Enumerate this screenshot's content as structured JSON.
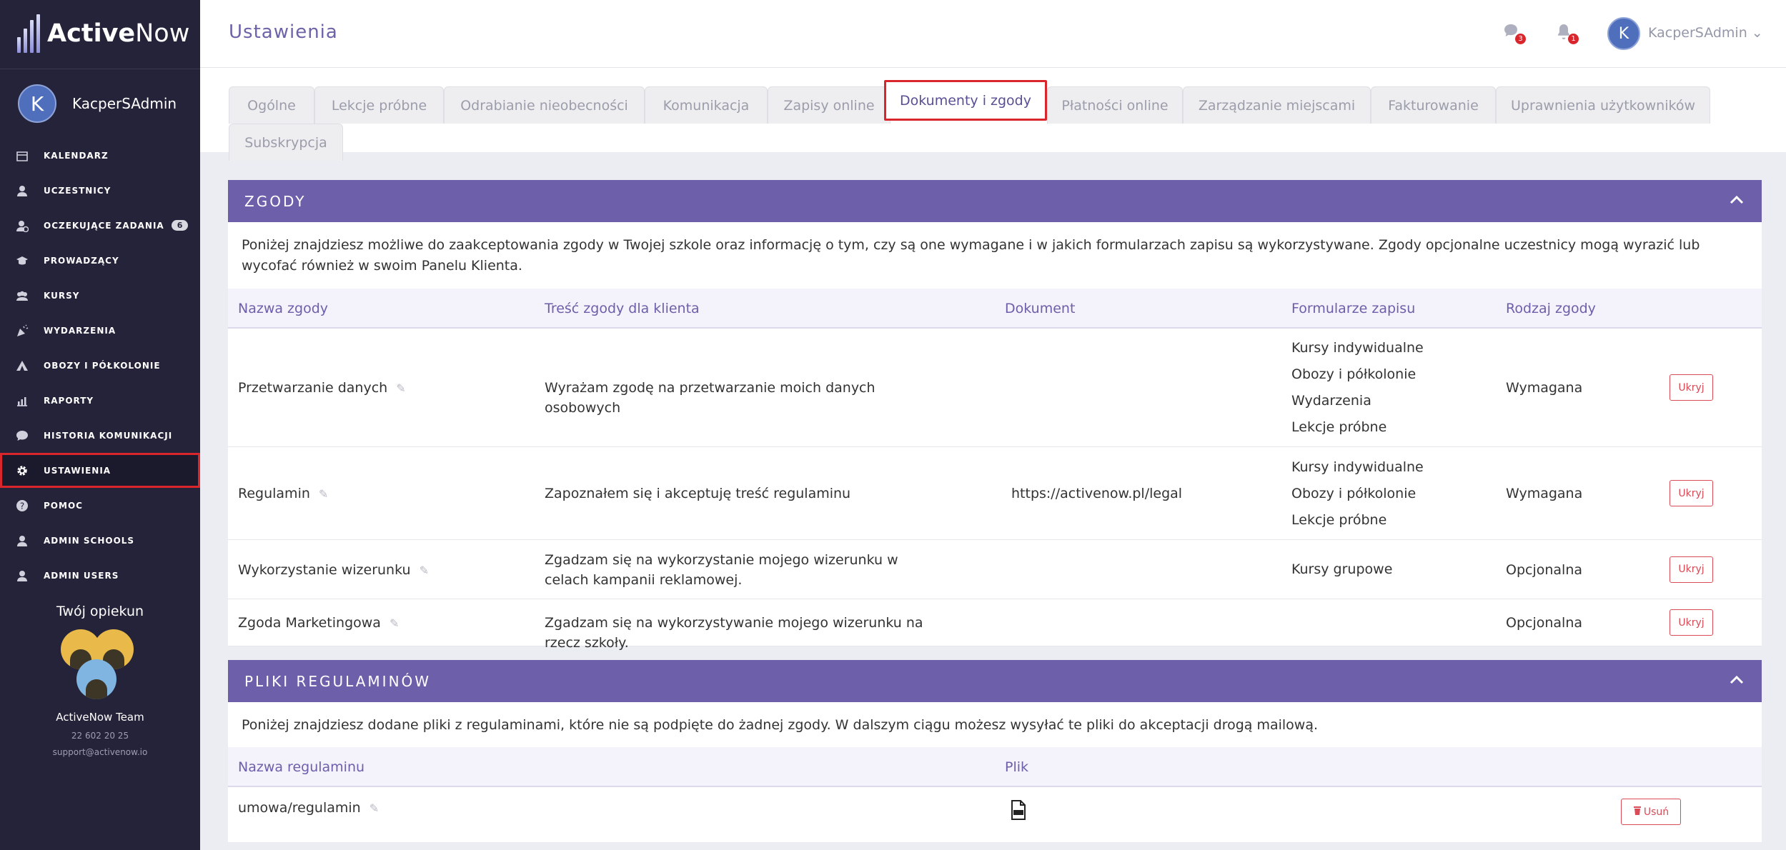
{
  "brand": {
    "name_bold": "Active",
    "name_light": "Now"
  },
  "user": {
    "initial": "K",
    "name": "KacperSAdmin"
  },
  "nav": [
    {
      "label": "KALENDARZ",
      "icon": "calendar-icon"
    },
    {
      "label": "UCZESTNICY",
      "icon": "user-icon"
    },
    {
      "label": "OCZEKUJĄCE ZADANIA",
      "icon": "user-clock-icon",
      "badge": "6"
    },
    {
      "label": "PROWADZĄCY",
      "icon": "graduation-cap-icon"
    },
    {
      "label": "KURSY",
      "icon": "users-group-icon"
    },
    {
      "label": "WYDARZENIA",
      "icon": "party-icon"
    },
    {
      "label": "OBOZY I PÓŁKOLONIE",
      "icon": "tent-icon"
    },
    {
      "label": "RAPORTY",
      "icon": "chart-icon"
    },
    {
      "label": "HISTORIA KOMUNIKACJI",
      "icon": "chat-icon"
    },
    {
      "label": "USTAWIENIA",
      "icon": "gear-icon",
      "active": true
    },
    {
      "label": "POMOC",
      "icon": "help-icon"
    },
    {
      "label": "ADMIN SCHOOLS",
      "icon": "user-icon"
    },
    {
      "label": "ADMIN USERS",
      "icon": "user-icon"
    }
  ],
  "caretaker": {
    "title": "Twój opiekun",
    "team": "ActiveNow Team",
    "phone": "22 602 20 25",
    "email": "support@activenow.io"
  },
  "header": {
    "title": "Ustawienia",
    "chat_badge": "3",
    "bell_badge": "1",
    "user_initial": "K",
    "user_name": "KacperSAdmin ⌄"
  },
  "tabs": [
    "Ogólne",
    "Lekcje próbne",
    "Odrabianie nieobecności",
    "Komunikacja",
    "Zapisy online",
    "Dokumenty i zgody",
    "Płatności online",
    "Zarządzanie miejscami",
    "Fakturowanie",
    "Uprawnienia użytkowników",
    "Subskrypcja"
  ],
  "consents": {
    "title": "ZGODY",
    "description": "Poniżej znajdziesz możliwe do zaakceptowania zgody w Twojej szkole oraz informację o tym, czy są one wymagane i w jakich formularzach zapisu są wykorzystywane. Zgody opcjonalne uczestnicy mogą wyrazić lub wycofać również w swoim Panelu Klienta.",
    "columns": [
      "Nazwa zgody",
      "Treść zgody dla klienta",
      "Dokument",
      "Formularze zapisu",
      "Rodzaj zgody"
    ],
    "hide_label": "Ukryj",
    "rows": [
      {
        "name": "Przetwarzanie danych",
        "content": "Wyrażam zgodę na przetwarzanie moich danych osobowych",
        "document": "",
        "forms": [
          "Kursy indywidualne",
          "Obozy i półkolonie",
          "Wydarzenia",
          "Lekcje próbne"
        ],
        "type": "Wymagana"
      },
      {
        "name": "Regulamin",
        "content": "Zapoznałem się i akceptuję treść regulaminu",
        "document": "https://activenow.pl/legal",
        "forms": [
          "Kursy indywidualne",
          "Obozy i półkolonie",
          "Lekcje próbne"
        ],
        "type": "Wymagana"
      },
      {
        "name": "Wykorzystanie wizerunku",
        "content": "Zgadzam się na wykorzystanie mojego wizerunku w celach kampanii reklamowej.",
        "document": "",
        "forms": [
          "Kursy grupowe"
        ],
        "type": "Opcjonalna"
      },
      {
        "name": "Zgoda Marketingowa",
        "content": "Zgadzam się na wykorzystywanie mojego wizerunku na rzecz szkoły.",
        "document": "",
        "forms": [],
        "type": "Opcjonalna"
      }
    ]
  },
  "regulations": {
    "title": "PLIKI REGULAMINÓW",
    "description": "Poniżej znajdziesz dodane pliki z regulaminami, które nie są podpięte do żadnej zgody. W dalszym ciągu możesz wysyłać te pliki do akceptacji drogą mailową.",
    "columns": [
      "Nazwa regulaminu",
      "Plik"
    ],
    "rows": [
      {
        "name": "umowa/regulamin",
        "file_icon": "pdf-file-icon"
      }
    ],
    "delete_label": "Usuń"
  },
  "colors": {
    "sidebar": "#24233a",
    "accent": "#6d5fa9",
    "danger": "#d94b56",
    "highlight": "#d8262c"
  }
}
